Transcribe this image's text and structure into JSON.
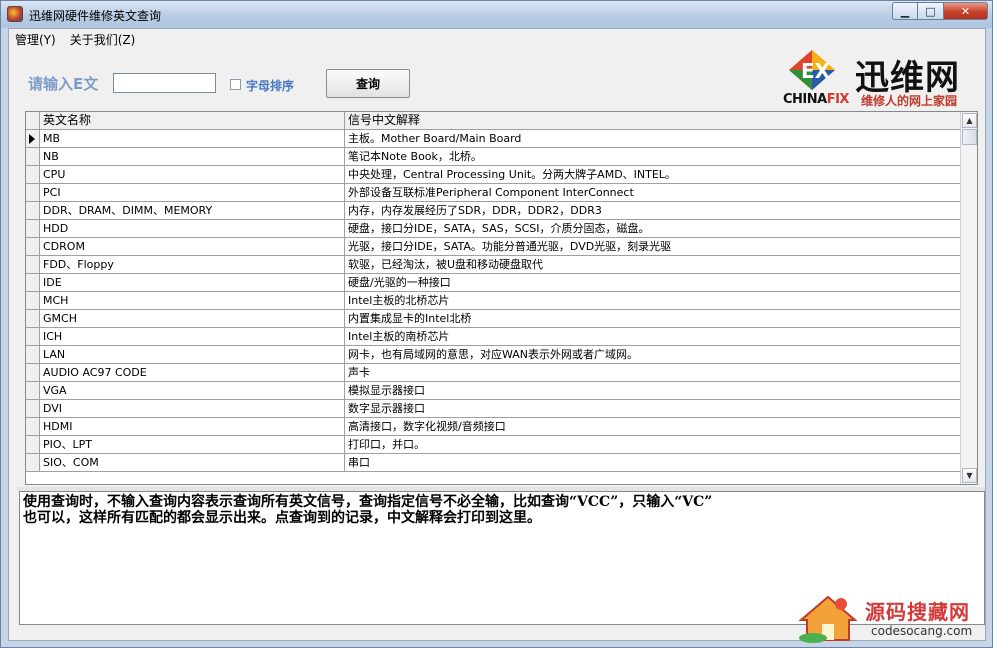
{
  "window": {
    "title": "迅维网硬件维修英文查询",
    "minimize_label": "▁",
    "maximize_label": "□",
    "close_label": "✕"
  },
  "menu": [
    {
      "label": "管理(Y)"
    },
    {
      "label": "关于我们(Z)"
    }
  ],
  "form": {
    "prompt": "请输入E文",
    "query_value": "",
    "sort_label": "字母排序",
    "sort_checked": false,
    "query_button": "查询"
  },
  "logo": {
    "name_cn": "迅维网",
    "name_en_a": "CHINA",
    "name_en_b": "FIX",
    "slogan": "维修人的网上家园"
  },
  "grid": {
    "columns": [
      "英文名称",
      "信号中文解释"
    ],
    "selected_row": 0,
    "rows": [
      [
        "MB",
        "主板。Mother Board/Main Board"
      ],
      [
        "NB",
        "笔记本Note Book，北桥。"
      ],
      [
        "CPU",
        "中央处理，Central Processing Unit。分两大牌子AMD、INTEL。"
      ],
      [
        "PCI",
        "外部设备互联标准Peripheral Component InterConnect"
      ],
      [
        "DDR、DRAM、DIMM、MEMORY",
        "内存，内存发展经历了SDR，DDR，DDR2，DDR3"
      ],
      [
        "HDD",
        "硬盘，接口分IDE，SATA，SAS，SCSI，介质分固态，磁盘。"
      ],
      [
        "CDROM",
        "光驱，接口分IDE，SATA。功能分普通光驱，DVD光驱，刻录光驱"
      ],
      [
        "FDD、Floppy",
        "软驱，已经淘汰，被U盘和移动硬盘取代"
      ],
      [
        "IDE",
        "硬盘/光驱的一种接口"
      ],
      [
        "MCH",
        "Intel主板的北桥芯片"
      ],
      [
        "GMCH",
        "内置集成显卡的Intel北桥"
      ],
      [
        "ICH",
        "Intel主板的南桥芯片"
      ],
      [
        "LAN",
        "网卡，也有局域网的意思，对应WAN表示外网或者广域网。"
      ],
      [
        "AUDIO AC97 CODE",
        "声卡"
      ],
      [
        "VGA",
        "模拟显示器接口"
      ],
      [
        "DVI",
        "数字显示器接口"
      ],
      [
        "HDMI",
        "高清接口，数字化视频/音频接口"
      ],
      [
        "PIO、LPT",
        "打印口，并口。"
      ],
      [
        "SIO、COM",
        "串口"
      ]
    ]
  },
  "memo": {
    "line1": "使用查询时，不输入查询内容表示查询所有英文信号，查询指定信号不必全输，比如查询“VCC”，只输入“VC”",
    "line2": "也可以，这样所有匹配的都会显示出来。点查询到的记录，中文解释会打印到这里。"
  },
  "watermark": {
    "name_cn": "源码搜藏网",
    "url": "codesocang.com"
  }
}
